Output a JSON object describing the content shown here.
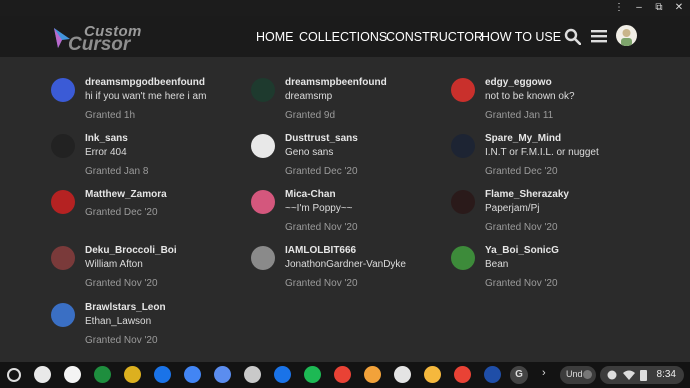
{
  "header": {
    "logo_top": "Custom",
    "logo_bottom": "Cursor",
    "nav": [
      {
        "label": "HOME"
      },
      {
        "label": "COLLECTIONS"
      },
      {
        "label": "CONSTRUCTOR"
      },
      {
        "label": "HOW TO USE"
      }
    ]
  },
  "users": [
    {
      "name": "dreamsmpgodbeenfound",
      "desc": "hi if you wan't me here i am",
      "when": "Granted 1h",
      "color": "#3b5bd6"
    },
    {
      "name": "dreamsmpbeenfound",
      "desc": "dreamsmp",
      "when": "Granted 9d",
      "color": "#1e3a2e"
    },
    {
      "name": "edgy_eggowo",
      "desc": "not to be known ok?",
      "when": "Granted Jan 11",
      "color": "#c9302c"
    },
    {
      "name": "Ink_sans",
      "desc": "Error 404",
      "when": "Granted Jan 8",
      "color": "#222222"
    },
    {
      "name": "Dusttrust_sans",
      "desc": "Geno sans",
      "when": "Granted Dec '20",
      "color": "#e8e8e8"
    },
    {
      "name": "Spare_My_Mind",
      "desc": "I.N.T or F.M.I.L. or nugget",
      "when": "Granted Dec '20",
      "color": "#1d2433"
    },
    {
      "name": "Matthew_Zamora",
      "desc": "",
      "when": "Granted Dec '20",
      "color": "#b52222"
    },
    {
      "name": "Mica-Chan",
      "desc": "~~I'm Poppy~~",
      "when": "Granted Nov '20",
      "color": "#d4577d"
    },
    {
      "name": "Flame_Sherazaky",
      "desc": "Paperjam/Pj",
      "when": "Granted Nov '20",
      "color": "#2a1a1a"
    },
    {
      "name": "Deku_Broccoli_Boi",
      "desc": "William Afton",
      "when": "Granted Nov '20",
      "color": "#7a3a3a"
    },
    {
      "name": "IAMLOLBIT666",
      "desc": "JonathonGardner-VanDyke",
      "when": "Granted Nov '20",
      "color": "#8a8a8a"
    },
    {
      "name": "Ya_Boi_SonicG",
      "desc": "Bean",
      "when": "Granted Nov '20",
      "color": "#3d8b3a"
    },
    {
      "name": "Brawlstars_Leon",
      "desc": "Ethan_Lawson",
      "when": "Granted Nov '20",
      "color": "#3a6fc4"
    }
  ],
  "shelf": {
    "apps": [
      {
        "name": "gmail-icon",
        "color": "#e9e9e9"
      },
      {
        "name": "drive-icon",
        "color": "#f4f4f4"
      },
      {
        "name": "classroom-icon",
        "color": "#1e8e3e"
      },
      {
        "name": "chrome-icon",
        "color": "#dcb01f"
      },
      {
        "name": "meet-icon",
        "color": "#1a73e8"
      },
      {
        "name": "docs-icon",
        "color": "#4285f4"
      },
      {
        "name": "spotify-icon",
        "color": "#1db954"
      },
      {
        "name": "paint-icon",
        "color": "#e94235"
      },
      {
        "name": "files-icon",
        "color": "#c9c9c9"
      },
      {
        "name": "settings-icon",
        "color": "#5b8def"
      },
      {
        "name": "messages-icon",
        "color": "#1db954"
      },
      {
        "name": "music-icon",
        "color": "#e94235"
      },
      {
        "name": "app-icon-13",
        "color": "#f2a23a"
      },
      {
        "name": "app-icon-14",
        "color": "#e4e4e4"
      },
      {
        "name": "app-icon-15",
        "color": "#f5b83d"
      },
      {
        "name": "app-icon-16",
        "color": "#1f4ea8"
      }
    ],
    "avatar_letter": "G",
    "ime": "Und",
    "time": "8:34"
  }
}
